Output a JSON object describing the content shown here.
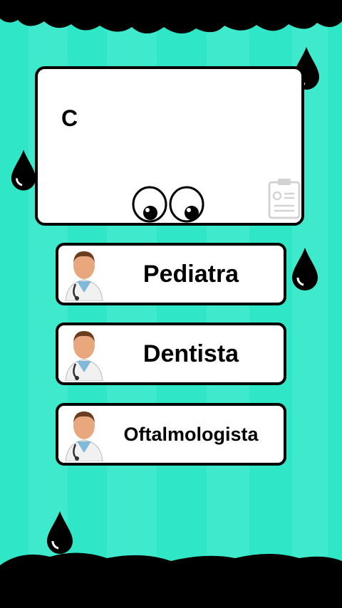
{
  "question": {
    "text": "C"
  },
  "options": [
    {
      "label": "Pediatra",
      "icon": "doctor-icon"
    },
    {
      "label": "Dentista",
      "icon": "doctor-icon"
    },
    {
      "label": "Oftalmologista",
      "icon": "doctor-icon"
    }
  ],
  "colors": {
    "background": "#2fe6c6",
    "stripe_light": "#45eccf",
    "ink": "#000000",
    "card": "#ffffff"
  }
}
